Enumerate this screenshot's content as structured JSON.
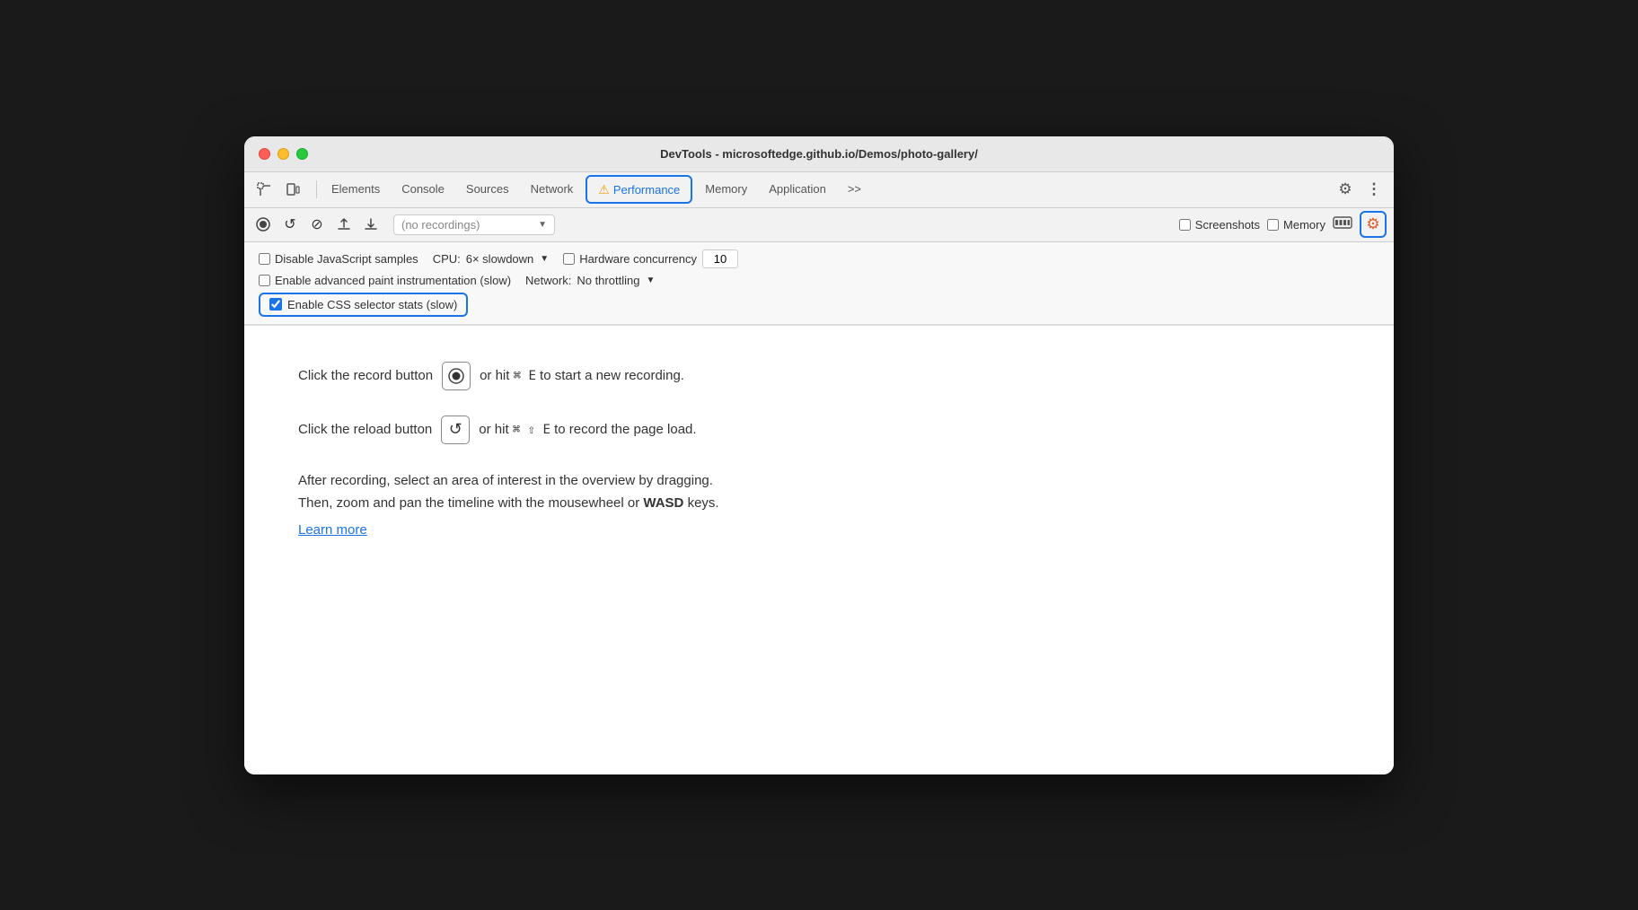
{
  "window": {
    "title": "DevTools - microsoftedge.github.io/Demos/photo-gallery/"
  },
  "tabs": {
    "items": [
      {
        "id": "elements",
        "label": "Elements",
        "active": false
      },
      {
        "id": "console",
        "label": "Console",
        "active": false
      },
      {
        "id": "sources",
        "label": "Sources",
        "active": false
      },
      {
        "id": "network",
        "label": "Network",
        "active": false
      },
      {
        "id": "performance",
        "label": "Performance",
        "active": true
      },
      {
        "id": "memory",
        "label": "Memory",
        "active": false
      },
      {
        "id": "application",
        "label": "Application",
        "active": false
      },
      {
        "id": "overflow",
        "label": ">>",
        "active": false
      }
    ]
  },
  "toolbar": {
    "recordings_placeholder": "(no recordings)",
    "screenshots_label": "Screenshots",
    "memory_label": "Memory"
  },
  "settings": {
    "disable_js_samples_label": "Disable JavaScript samples",
    "enable_advanced_paint_label": "Enable advanced paint instrumentation (slow)",
    "enable_css_selector_label": "Enable CSS selector stats (slow)",
    "cpu_label": "CPU:",
    "cpu_value": "6× slowdown",
    "network_label": "Network:",
    "network_value": "No throttling",
    "hw_concurrency_label": "Hardware concurrency",
    "hw_concurrency_value": "10"
  },
  "main": {
    "instruction1_pre": "Click the record button",
    "instruction1_post": "or hit ⌘ E to start a new recording.",
    "instruction2_pre": "Click the reload button",
    "instruction2_post": "or hit ⌘ ⇧ E to record the page load.",
    "description_line1": "After recording, select an area of interest in the overview by dragging.",
    "description_line2": "Then, zoom and pan the timeline with the mousewheel or",
    "description_bold": "WASD",
    "description_line2_end": "keys.",
    "learn_more": "Learn more"
  },
  "icons": {
    "inspect": "⌗",
    "device": "⧉",
    "record": "⏺",
    "reload": "↺",
    "clear": "⊘",
    "upload": "↑",
    "download": "↓",
    "gear": "⚙",
    "more": "⋮",
    "settings_cog": "⚙"
  }
}
